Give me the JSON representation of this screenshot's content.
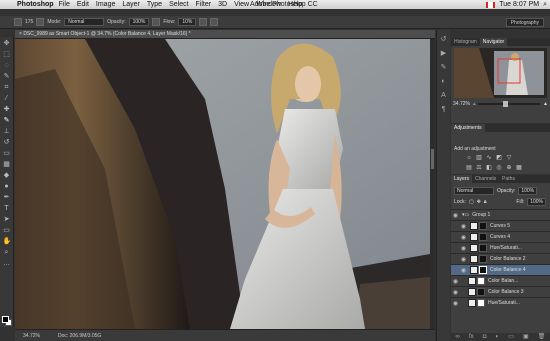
{
  "menubar": {
    "app_name": "Photoshop",
    "menus": [
      "File",
      "Edit",
      "Image",
      "Layer",
      "Type",
      "Select",
      "Filter",
      "3D",
      "View",
      "Window",
      "Help"
    ],
    "window_title": "Adobe Photoshop CC",
    "clock": "Tue 8:07 PM"
  },
  "options": {
    "brush_size": "175",
    "mode_label": "Mode:",
    "mode_value": "Normal",
    "opacity_label": "Opacity:",
    "opacity_value": "100%",
    "flow_label": "Flow:",
    "flow_value": "10%",
    "workspace": "Photography"
  },
  "document": {
    "tab_title": "DSC_9989 as Smart Object-1 @ 34.7% (Color Balance 4, Layer Mask/16) *",
    "zoom": "34.72%",
    "doc_size": "Doc: 206.9M/3.05G"
  },
  "navigator": {
    "tabs": [
      "Histogram",
      "Navigator"
    ],
    "zoom": "34.72%"
  },
  "adjustments": {
    "tab": "Adjustments",
    "title": "Add an adjustment"
  },
  "layers": {
    "tabs": [
      "Layers",
      "Channels",
      "Paths"
    ],
    "blend_mode": "Normal",
    "opacity_label": "Opacity:",
    "opacity_value": "100%",
    "lock_label": "Lock:",
    "fill_label": "Fill:",
    "fill_value": "100%",
    "items": [
      {
        "name": "Group 1"
      },
      {
        "name": "Curves 5"
      },
      {
        "name": "Curves 4"
      },
      {
        "name": "Hue/Saturati..."
      },
      {
        "name": "Color Balance 2"
      },
      {
        "name": "Color Balance 4"
      },
      {
        "name": "Color Balan..."
      },
      {
        "name": "Color Balance 3"
      },
      {
        "name": "Hue/Saturati..."
      }
    ]
  }
}
